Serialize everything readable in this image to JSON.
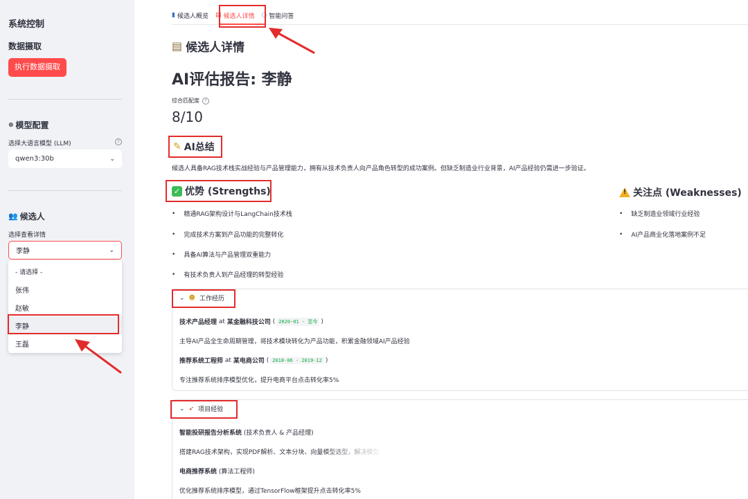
{
  "sidebar": {
    "title": "系统控制",
    "data_section": "数据摄取",
    "run_button": "执行数据摄取",
    "model_section": "模型配置",
    "model_label": "选择大语言模型 (LLM)",
    "model_value": "qwen3:30b",
    "candidate_section": "候选人",
    "candidate_label": "选择查看详情",
    "candidate_value": "李静",
    "options": [
      "- 请选择 -",
      "张伟",
      "赵敏",
      "李静",
      "王磊"
    ]
  },
  "tabs": [
    {
      "label": "候选人概览",
      "icon": "bar-chart-icon"
    },
    {
      "label": "候选人详情",
      "icon": "clipboard-icon"
    },
    {
      "label": "智能问答",
      "icon": "speech-bubble-icon"
    }
  ],
  "main": {
    "detail_title": "候选人详情",
    "report_title": "AI评估报告: 李静",
    "metric_label": "综合匹配度",
    "metric_value": "8/10",
    "summary_title": "AI总结",
    "summary_text": "候选人具备RAG技术栈实战经验与产品管理能力，拥有从技术负责人向产品角色转型的成功案例。但缺乏制造业行业背景，AI产品经验仍需进一步验证。",
    "strengths_title": "优势 (Strengths)",
    "strengths": [
      "精通RAG架构设计与LangChain技术栈",
      "完成技术方案到产品功能的完整转化",
      "具备AI算法与产品管理双重能力",
      "有技术负责人到产品经理的转型经验"
    ],
    "weaknesses_title": "关注点 (Weaknesses)",
    "weaknesses": [
      "缺乏制造业领域行业经验",
      "AI产品商业化落地案例不足"
    ],
    "work_title": "工作经历",
    "work": [
      {
        "role": "技术产品经理",
        "at": "at",
        "company": "某金融科技公司",
        "period": "2020-01 - 至今",
        "desc": "主导AI产品全生命周期管理，将技术模块转化为产品功能，积累金融领域AI产品经验"
      },
      {
        "role": "推荐系统工程师",
        "at": "at",
        "company": "某电商公司",
        "period": "2018-06 - 2019-12",
        "desc": "专注推荐系统排序模型优化，提升电商平台点击转化率5%"
      }
    ],
    "projects_title": "项目经验",
    "projects": [
      {
        "name": "智能投研报告分析系统",
        "role": "(技术负责人 & 产品经理)",
        "desc": "搭建RAG技术架构，实现PDF解析、文本分块、向量模型选型，解决模型"
      },
      {
        "name": "电商推荐系统",
        "role": "(算法工程师)",
        "desc": "优化推荐系统排序模型，通过TensorFlow框架提升点击转化率5%"
      }
    ]
  },
  "colors": {
    "accent": "#ff4b4b",
    "annotation": "#e22b2b",
    "sidebar_bg": "#f0f2f6"
  }
}
